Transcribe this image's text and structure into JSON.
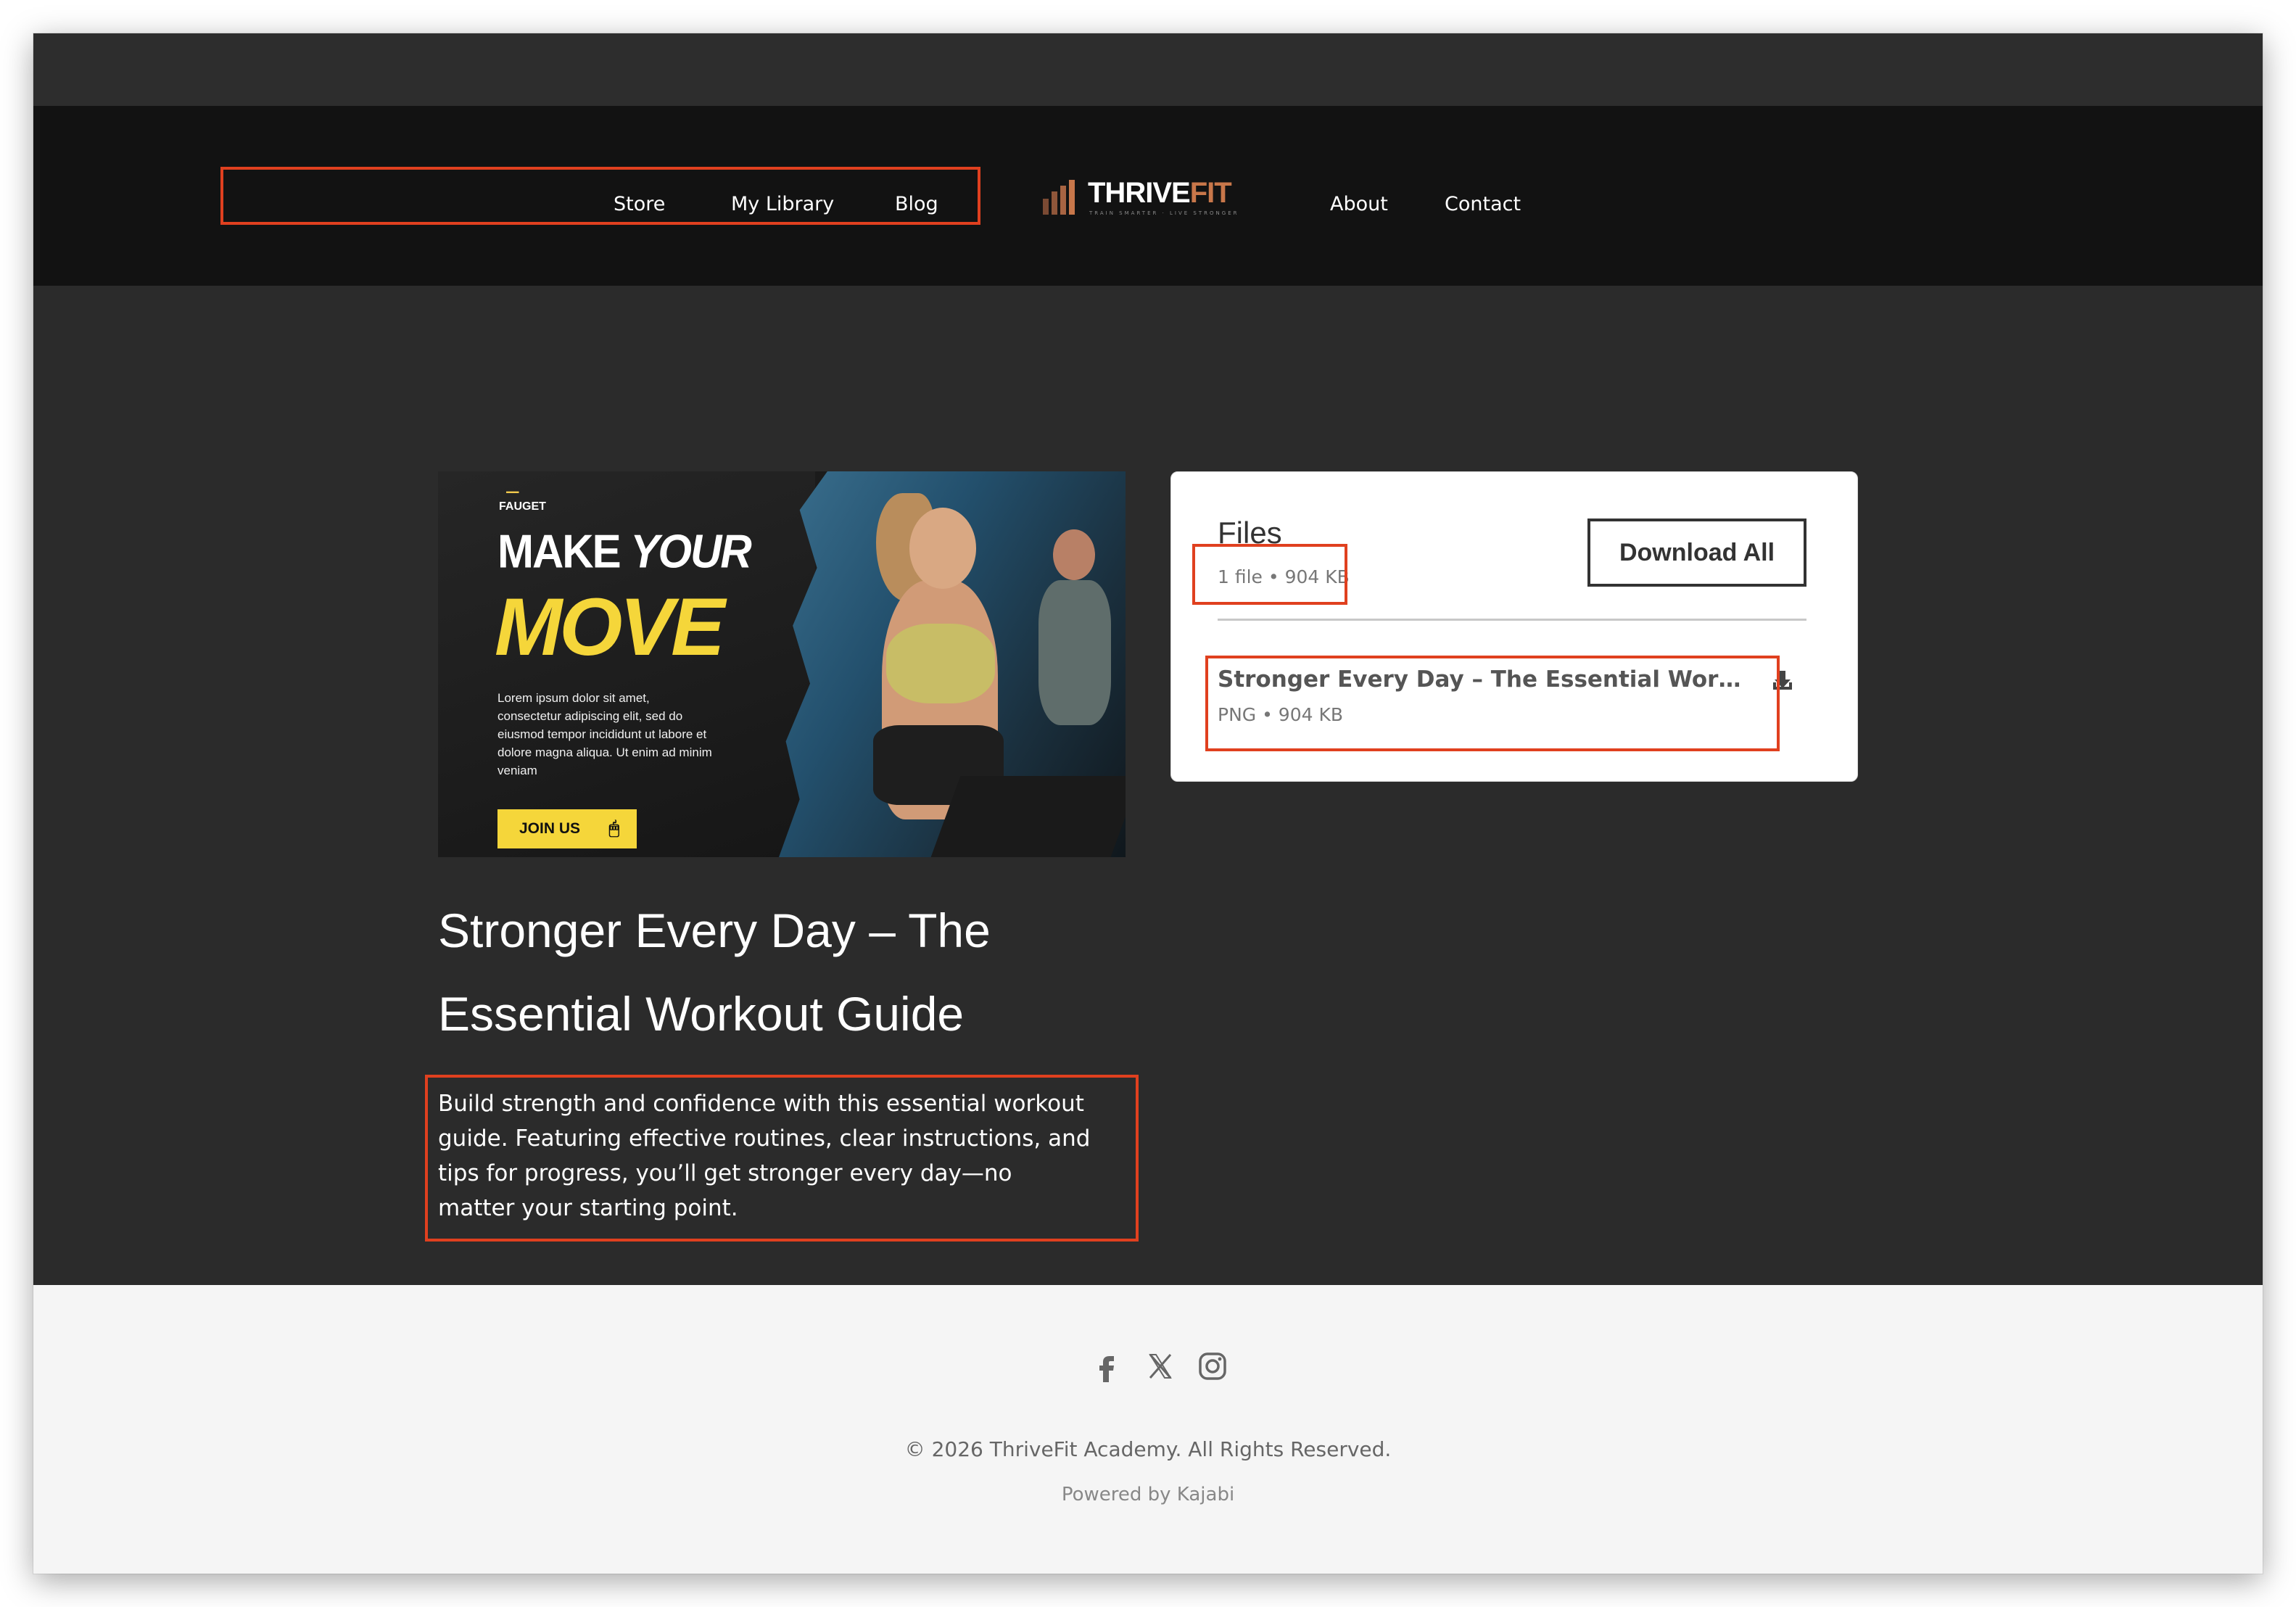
{
  "nav": {
    "left": [
      "Store",
      "My Library",
      "Blog"
    ],
    "right": [
      "About",
      "Contact"
    ]
  },
  "logo": {
    "main": "THRIVE",
    "accent": "FIT",
    "tagline": "TRAIN SMARTER · LIVE STRONGER",
    "accent_color": "#c8774a"
  },
  "hero_image": {
    "brand": "FAUGET",
    "headline_1": "MAKE",
    "headline_1_italic": "YOUR",
    "headline_2": "MOVE",
    "body": "Lorem ipsum dolor sit amet, consectetur adipiscing elit, sed do eiusmod tempor incididunt ut labore et dolore magna aliqua. Ut enim ad minim veniam",
    "cta": "JOIN US",
    "accent_color": "#f5d63a"
  },
  "files": {
    "title": "Files",
    "meta": "1 file • 904 KB",
    "download_all": "Download All",
    "items": [
      {
        "name": "Stronger Every Day – The Essential Workout G...",
        "meta": "PNG • 904 KB",
        "icon": "download-icon"
      }
    ]
  },
  "product": {
    "title": "Stronger Every Day – The Essential Workout Guide",
    "description": "Build strength and confidence with this essential workout guide. Featuring effective routines, clear instructions, and tips for progress, you’ll get stronger every day—no matter your starting point."
  },
  "footer": {
    "social": [
      "facebook-icon",
      "x-icon",
      "instagram-icon"
    ],
    "copyright": "© 2026 ThriveFit Academy. All Rights Reserved.",
    "powered": "Powered by Kajabi"
  },
  "colors": {
    "highlight": "#e0401f",
    "page_bg": "#2b2b2b",
    "header_bg": "#121212",
    "footer_bg": "#f5f5f5"
  }
}
